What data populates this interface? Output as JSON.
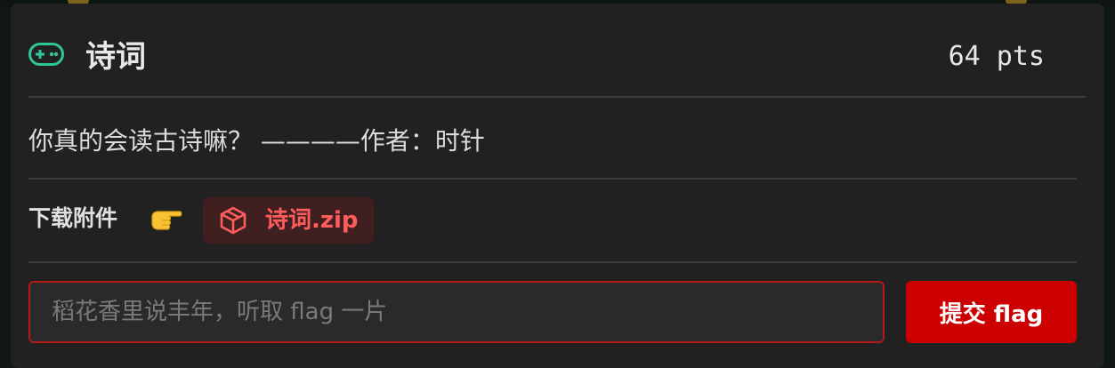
{
  "challenge": {
    "title": "诗词",
    "points": "64 pts",
    "icon": "gamepad-icon",
    "description": "你真的会读古诗嘛？ ————作者：时针"
  },
  "attachments": {
    "label": "下载附件",
    "pointer_icon": "pointing-hand-icon",
    "file": {
      "name": "诗词.zip",
      "icon": "cube-icon"
    }
  },
  "submission": {
    "placeholder": "稻花香里说丰年，听取 flag 一片",
    "value": "",
    "submit_label": "提交 flag"
  },
  "colors": {
    "accent_green": "#2ec79a",
    "danger_red": "#cc0000",
    "file_red": "#ff5c5c",
    "card_bg": "#212121"
  }
}
